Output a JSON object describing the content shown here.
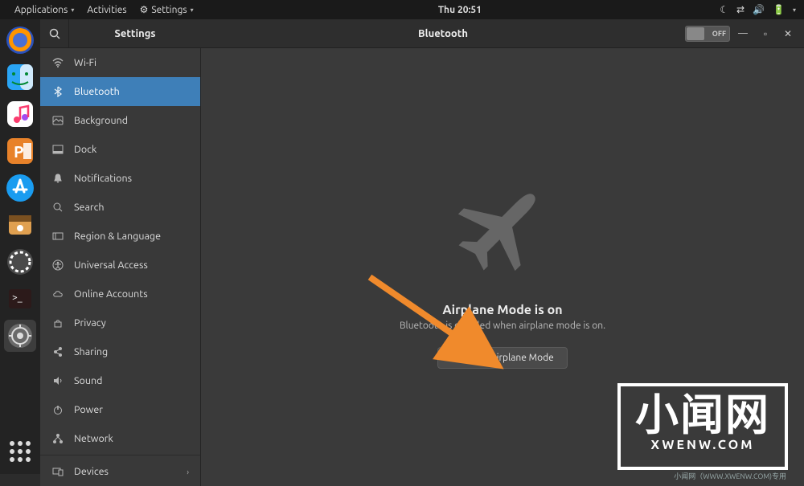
{
  "panel": {
    "applications": "Applications",
    "activities": "Activities",
    "app_menu": "Settings",
    "clock": "Thu 20:51"
  },
  "window": {
    "sidebar_title": "Settings",
    "page_title": "Bluetooth",
    "toggle_label": "OFF"
  },
  "sidebar": {
    "items": [
      {
        "label": "Wi-Fi"
      },
      {
        "label": "Bluetooth"
      },
      {
        "label": "Background"
      },
      {
        "label": "Dock"
      },
      {
        "label": "Notifications"
      },
      {
        "label": "Search"
      },
      {
        "label": "Region & Language"
      },
      {
        "label": "Universal Access"
      },
      {
        "label": "Online Accounts"
      },
      {
        "label": "Privacy"
      },
      {
        "label": "Sharing"
      },
      {
        "label": "Sound"
      },
      {
        "label": "Power"
      },
      {
        "label": "Network"
      },
      {
        "label": "Devices"
      }
    ]
  },
  "content": {
    "heading": "Airplane Mode is on",
    "subtext": "Bluetooth is disabled when airplane mode is on.",
    "button": "Turn Off Airplane Mode"
  },
  "watermark": {
    "big": "小闻网",
    "small": "XWENW.COM",
    "caption": "小闻网（WWW.XWENW.COM)专用"
  }
}
